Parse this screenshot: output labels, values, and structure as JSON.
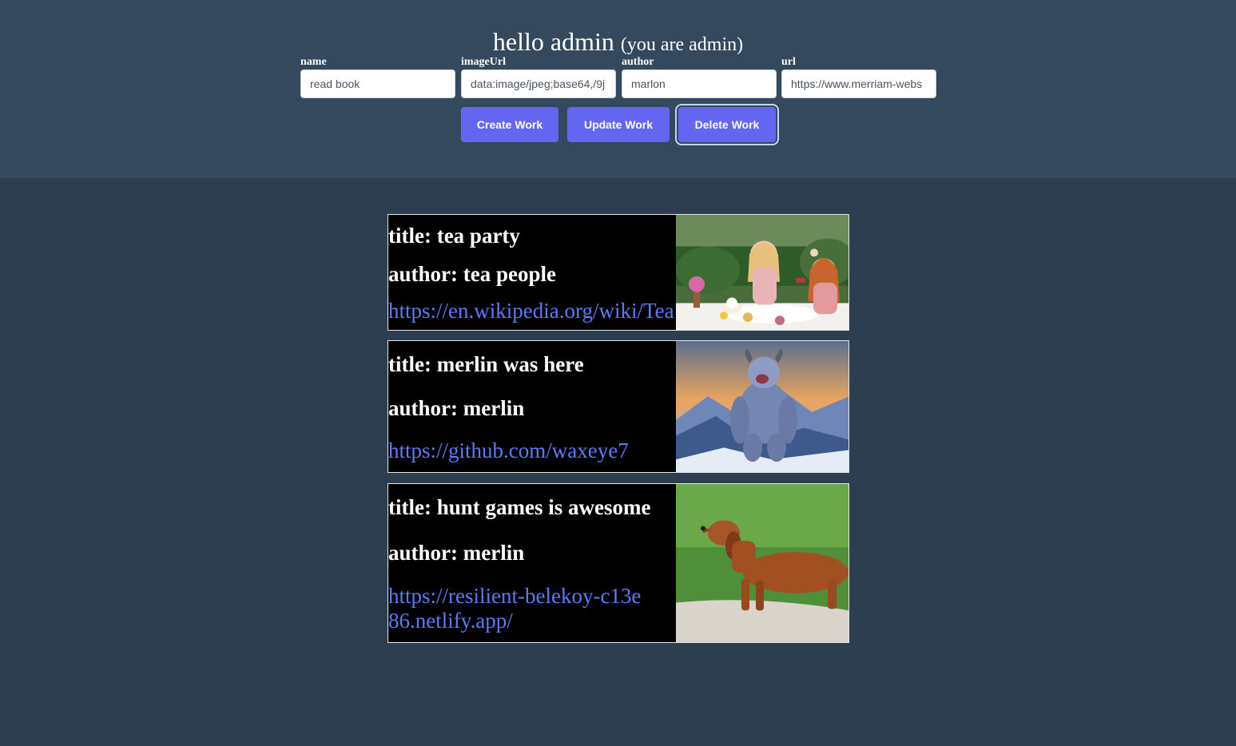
{
  "header": {
    "greeting": "hello admin",
    "role_note": "(you are admin)"
  },
  "form": {
    "fields": [
      {
        "label": "name",
        "value": "read book"
      },
      {
        "label": "imageUrl",
        "value": "data:image/jpeg;base64,/9j"
      },
      {
        "label": "author",
        "value": "marlon"
      },
      {
        "label": "url",
        "value": "https://www.merriam-webs"
      }
    ],
    "buttons": {
      "create": "Create Work",
      "update": "Update Work",
      "delete": "Delete Work"
    }
  },
  "works": [
    {
      "title": "title: tea party",
      "author": "author: tea people",
      "url": "https://en.wikipedia.org/wiki/Tea",
      "image": "tea-party-photo"
    },
    {
      "title": "title: merlin was here",
      "author": "author: merlin",
      "url": "https://github.com/waxeye7",
      "image": "yeti-photo"
    },
    {
      "title": "title: hunt games is awesome",
      "author": "author: merlin",
      "url": "https://resilient-belekoy-c13e86.netlify.app/",
      "image": "dachshund-photo"
    }
  ],
  "colors": {
    "header_bg": "#34495e",
    "page_bg": "#2d3e50",
    "button": "#6366f1",
    "link": "#5b7cf6"
  }
}
